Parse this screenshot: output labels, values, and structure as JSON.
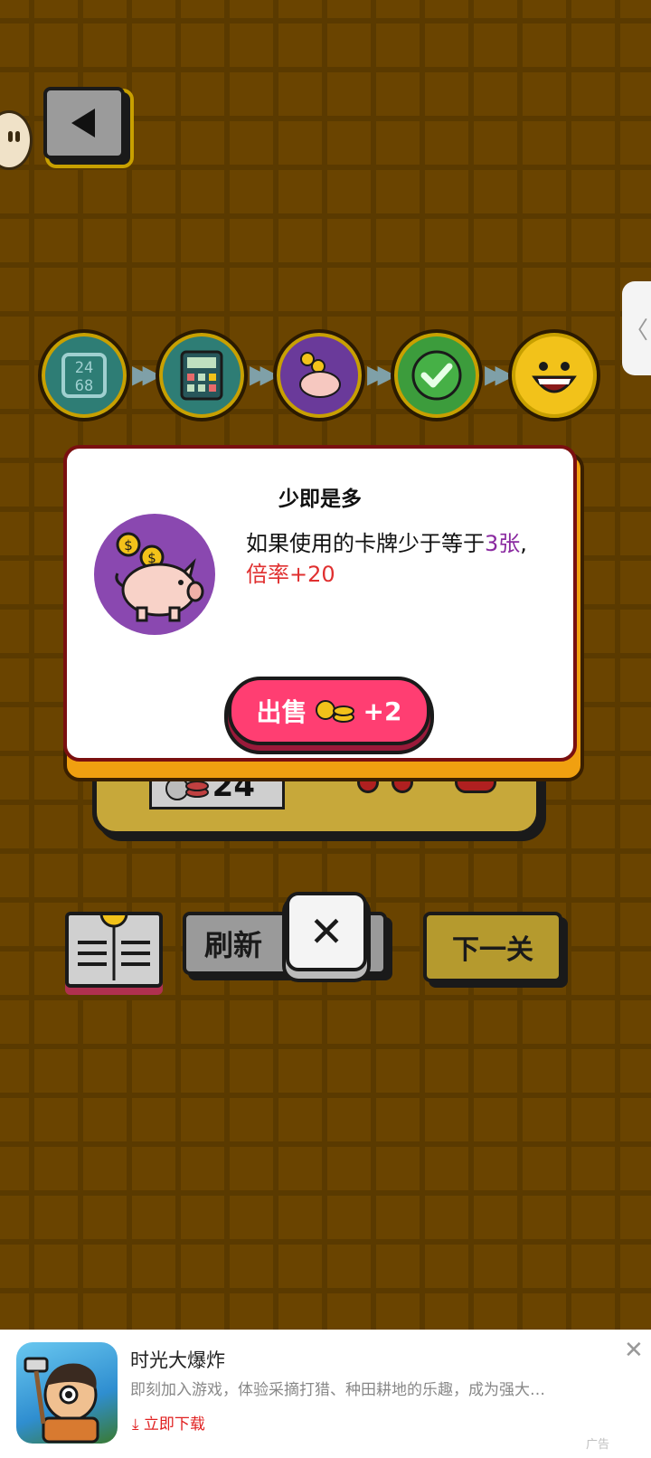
{
  "popup": {
    "title": "少即是多",
    "desc_main": "如果使用的卡牌少于等于",
    "desc_num": "3",
    "desc_unit": "张",
    "desc_comma": ",",
    "desc_effect": "倍率+20",
    "sell_label": "出售",
    "sell_amount": "+2"
  },
  "progress": {
    "steps": [
      "numbers-icon",
      "calculator-icon",
      "piggy-bank-icon",
      "checkmark-icon",
      "smiley-face-icon"
    ]
  },
  "machine": {
    "ticket_value": "24"
  },
  "buttons": {
    "refresh": "刷新",
    "next": "下一关",
    "close": "✕"
  },
  "ad": {
    "title": "时光大爆炸",
    "description": "即刻加入游戏，体验采摘打猎、种田耕地的乐趣，成为强大…",
    "download": "立即下载",
    "tag": "广告"
  },
  "colors": {
    "background": "#6a4400",
    "sell": "#ff3e72",
    "purple": "#8a48b0",
    "accent_red": "#e03030"
  }
}
